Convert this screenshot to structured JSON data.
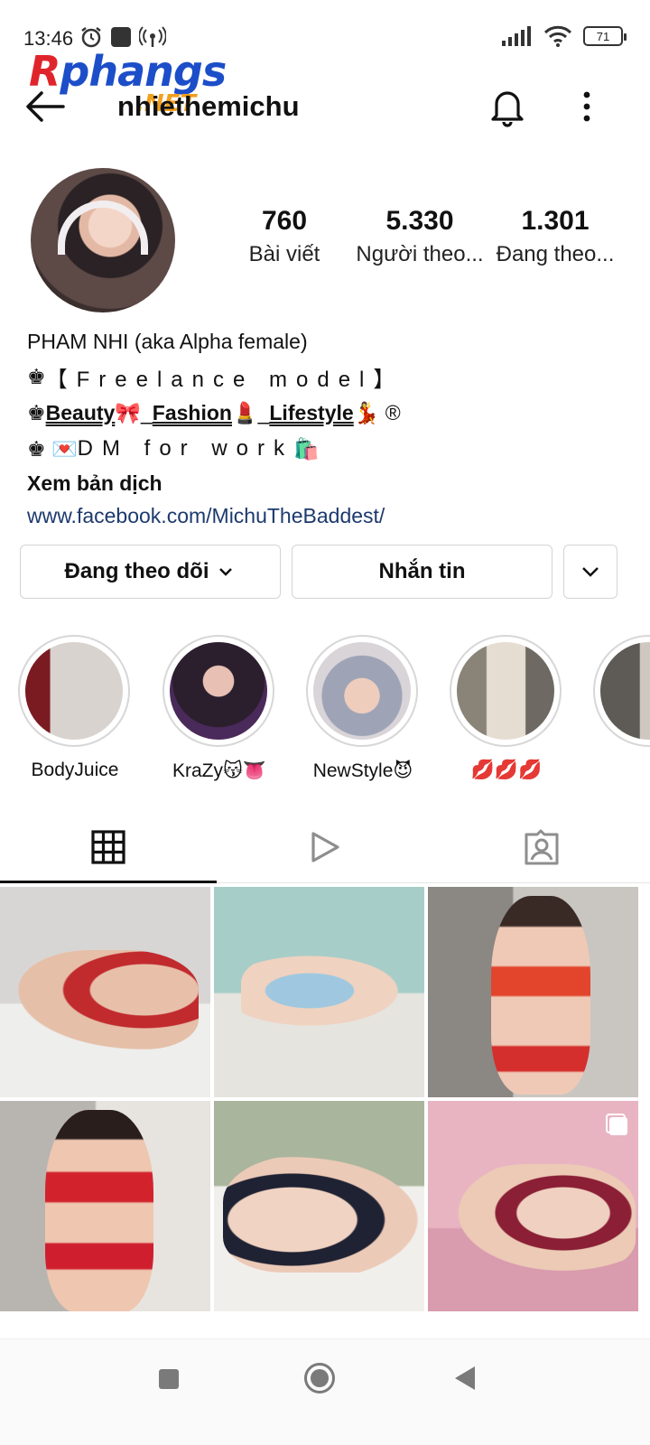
{
  "status_bar": {
    "time": "13:46",
    "battery": "71"
  },
  "watermark": {
    "brand_r": "R",
    "brand_rest": "phangs",
    "brand_net": ".NET"
  },
  "header": {
    "username": "nhiethemichu"
  },
  "profile": {
    "stats": [
      {
        "value": "760",
        "label": "Bài viết"
      },
      {
        "value": "5.330",
        "label": "Người theo..."
      },
      {
        "value": "1.301",
        "label": "Đang theo..."
      }
    ]
  },
  "bio": {
    "name": "PHAM NHI (aka Alpha female)",
    "line1_prefix": "♚",
    "line1": "【Freelance model】",
    "line2_prefix": "♚ ",
    "line2_beauty": "Beauty",
    "line2_e1": " 🎀_",
    "line2_fashion": "Fashion",
    "line2_e2": " 💄_",
    "line2_lifestyle": "Lifestyle",
    "line2_e3": " 💃 ®",
    "line3_prefix": "♚ 💌",
    "line3": "DM for work",
    "line3_suffix": "🛍️",
    "translate": "Xem bản dịch",
    "link": "www.facebook.com/MichuTheBaddest/"
  },
  "actions": {
    "following_label": "Đang theo dõi",
    "message_label": "Nhắn tin"
  },
  "highlights": [
    {
      "label": "BodyJuice"
    },
    {
      "label": "KraZy😽👅"
    },
    {
      "label": "NewStyle😈"
    },
    {
      "label": "💋💋💋"
    },
    {
      "label": ""
    }
  ],
  "tabs": [
    {
      "icon": "grid-icon"
    },
    {
      "icon": "reels-play-icon"
    },
    {
      "icon": "tagged-person-icon"
    }
  ],
  "colors": {
    "link": "#1d3a6e",
    "border": "#d4d4d4",
    "watermark_blue": "#1d4ec9",
    "watermark_red": "#e0242b",
    "watermark_orange": "#f2a01e"
  }
}
